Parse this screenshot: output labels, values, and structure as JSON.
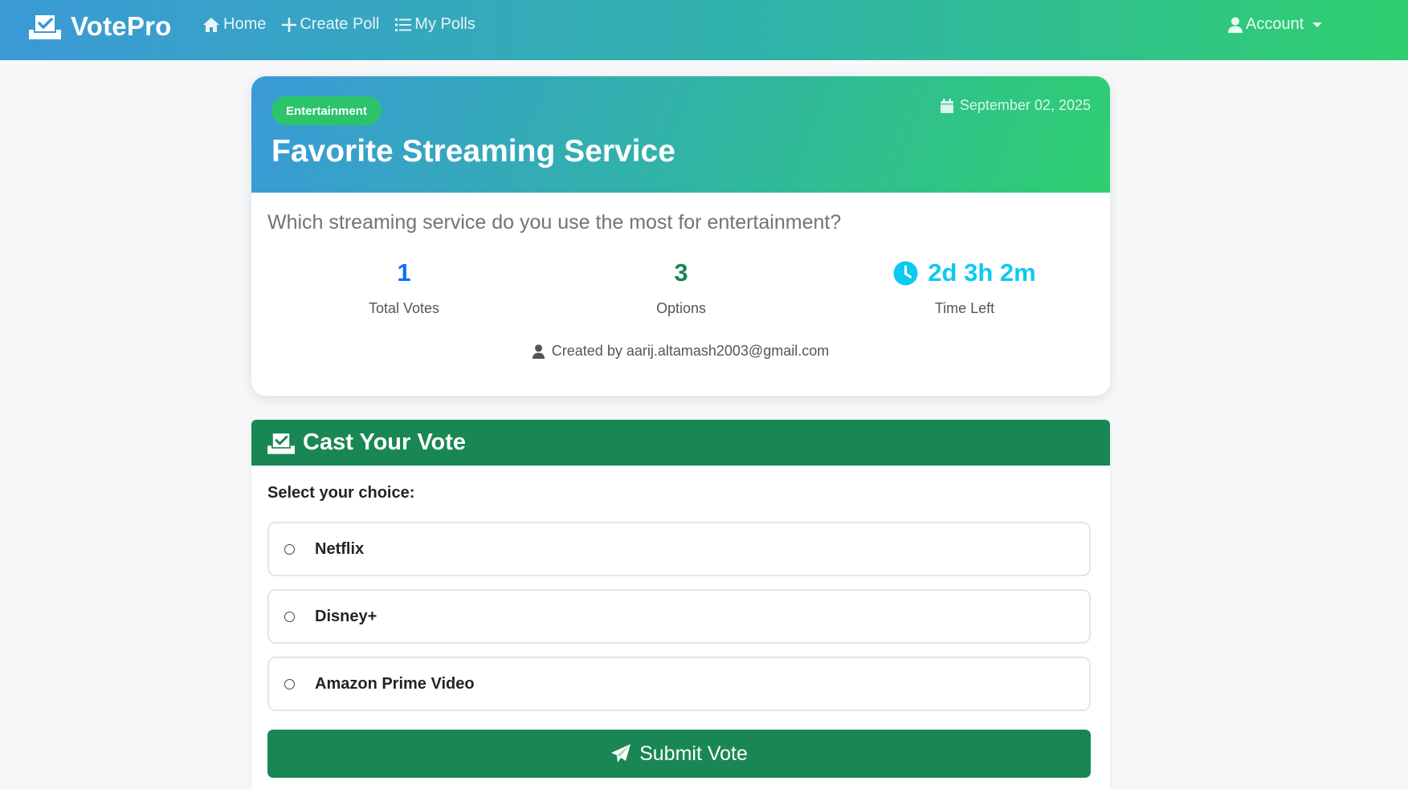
{
  "navbar": {
    "brand": "VotePro",
    "brand_icon": "vote-box-icon",
    "links": [
      {
        "label": "Home",
        "icon": "home-icon"
      },
      {
        "label": "Create Poll",
        "icon": "plus-icon"
      },
      {
        "label": "My Polls",
        "icon": "list-icon"
      }
    ],
    "account_label": "Account"
  },
  "poll": {
    "category": "Entertainment",
    "date": "September 02, 2025",
    "title": "Favorite Streaming Service",
    "question": "Which streaming service do you use the most for entertainment?",
    "stats": {
      "total_votes": "1",
      "total_votes_label": "Total Votes",
      "options": "3",
      "options_label": "Options",
      "time_left": "2d 3h 2m",
      "time_left_label": "Time Left"
    },
    "creator": "Created by aarij.altamash2003@gmail.com"
  },
  "vote": {
    "header": "Cast Your Vote",
    "select_label": "Select your choice:",
    "options": [
      "Netflix",
      "Disney+",
      "Amazon Prime Video"
    ],
    "submit_label": "Submit Vote"
  },
  "colors": {
    "primary_green": "#198754",
    "vote_count_blue": "#0d6efd",
    "time_cyan": "#0dcaf0",
    "gradient_start": "#3a9ad8",
    "gradient_end": "#2ecf70"
  }
}
